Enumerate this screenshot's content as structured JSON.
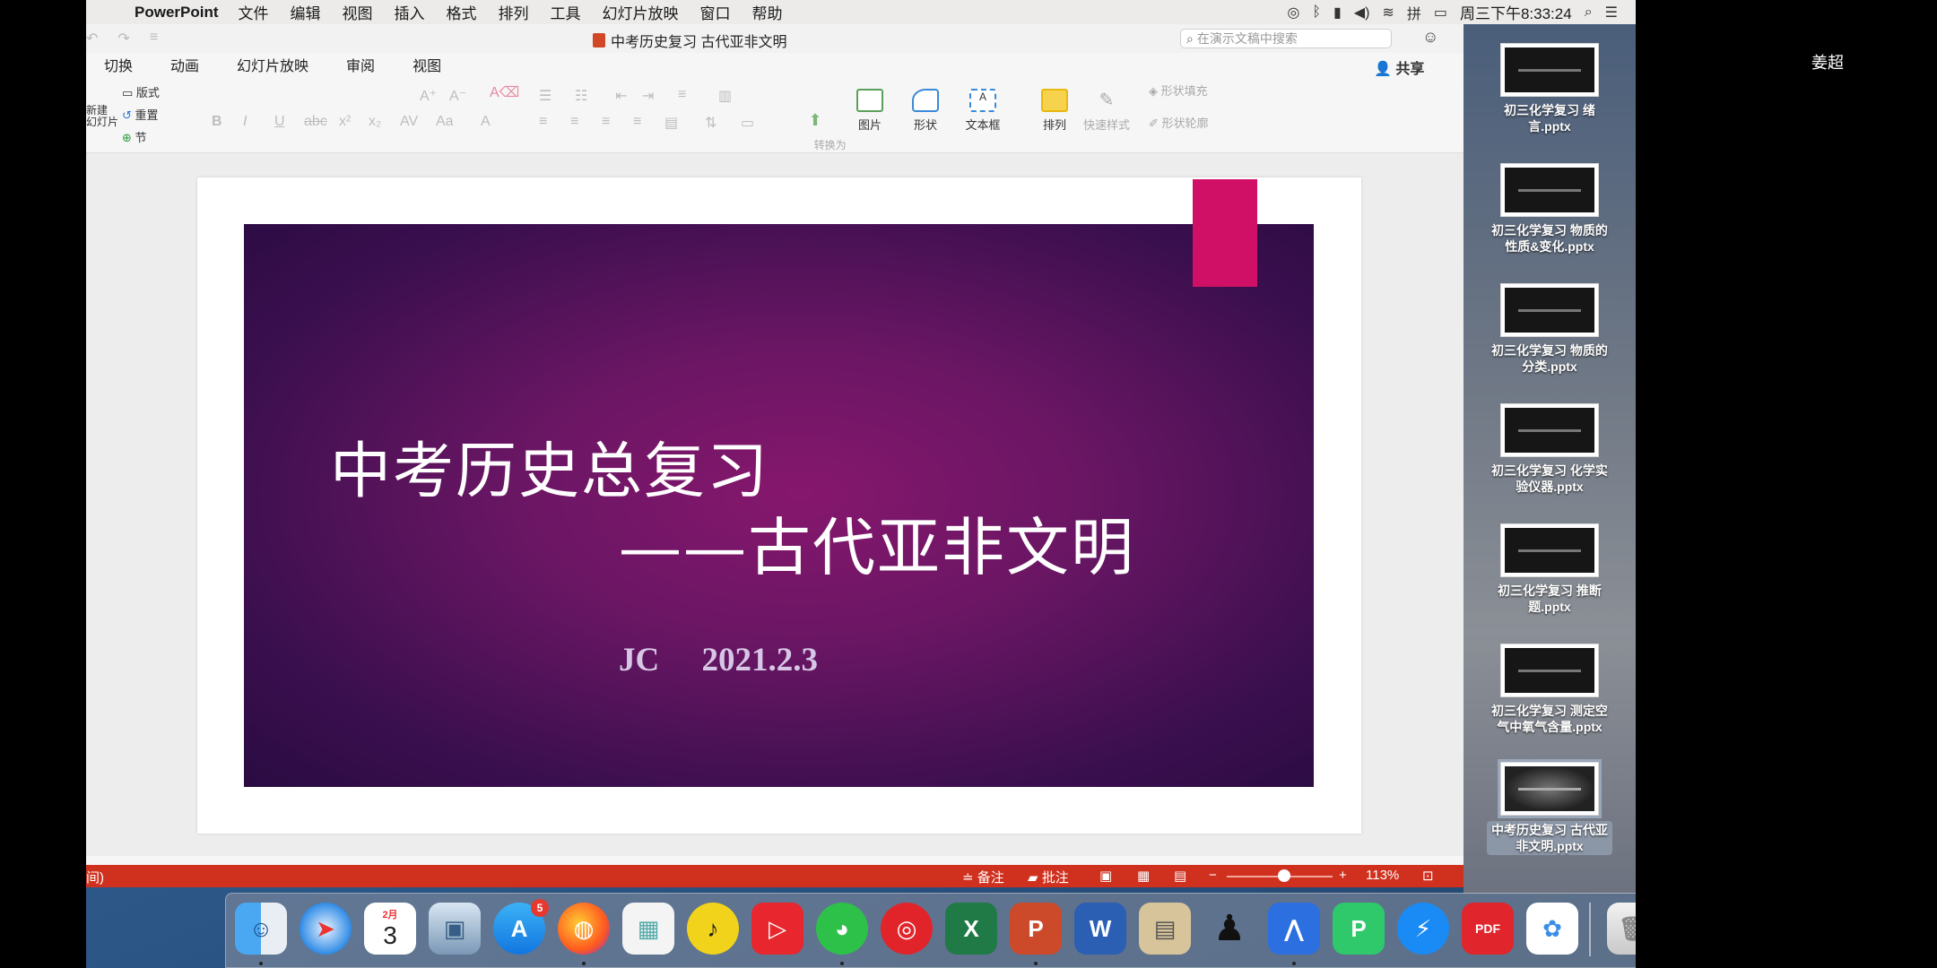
{
  "menubar": {
    "app_name": "PowerPoint",
    "items": [
      "文件",
      "编辑",
      "视图",
      "插入",
      "格式",
      "排列",
      "工具",
      "幻灯片放映",
      "窗口",
      "帮助"
    ],
    "clock": "周三下午8:33:24",
    "input_method": "拼"
  },
  "window": {
    "doc_title": "中考历史复习 古代亚非文明",
    "search_placeholder": "在演示文稿中搜索",
    "share_label": "共享"
  },
  "tabs": [
    "切换",
    "动画",
    "幻灯片放映",
    "审阅",
    "视图"
  ],
  "ribbon": {
    "layout_label": "版式",
    "reset_label": "重置",
    "section_label": "节",
    "new_slide_label": "新建\n幻灯片",
    "convert_smartart_label": "转换为\nSmartArt",
    "picture_label": "图片",
    "shape_label": "形状",
    "textbox_label": "文本框",
    "arrange_label": "排列",
    "quickstyle_label": "快速样式",
    "shape_fill_label": "形状填充",
    "shape_outline_label": "形状轮廓"
  },
  "slide": {
    "title": "中考历史总复习",
    "subtitle": "——古代亚非文明",
    "author": "JC",
    "date": "2021.2.3"
  },
  "statusbar": {
    "notes_label": "备注",
    "comments_label": "批注",
    "zoom_percent": "113%",
    "left_hint": "间)"
  },
  "desktop_files": [
    "初三化学复习 绪言.pptx",
    "初三化学复习 物质的性质&变化.pptx",
    "初三化学复习 物质的分类.pptx",
    "初三化学复习 化学实验仪器.pptx",
    "初三化学复习 推断题.pptx",
    "初三化学复习 测定空气中氧气含量.pptx",
    "中考历史复习 古代亚非文明.pptx"
  ],
  "user_name": "姜超",
  "dock": {
    "calendar_month": "2月",
    "calendar_day": "3",
    "appstore_badge": "5",
    "pdf_label": "PDF"
  }
}
